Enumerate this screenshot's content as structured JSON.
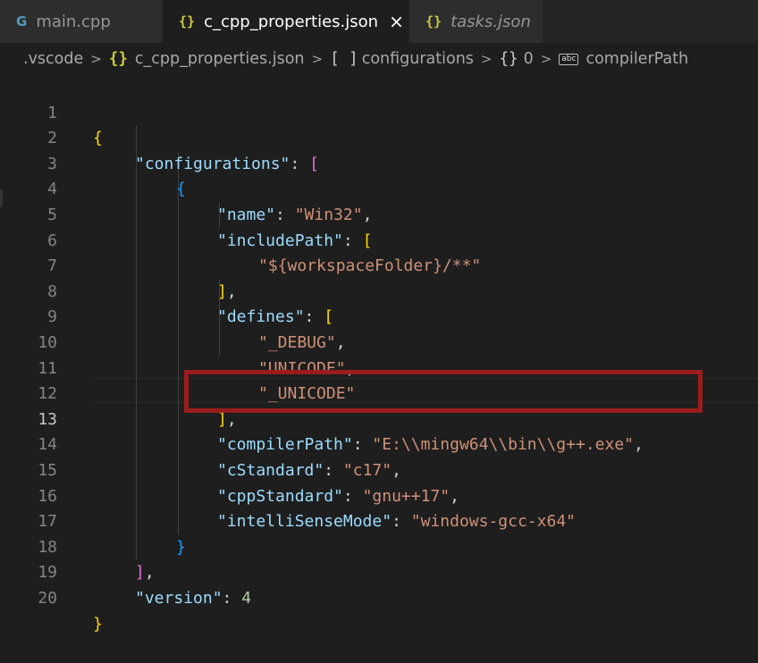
{
  "tabs": [
    {
      "icon": "cpp-file-icon",
      "icon_glyph": "G",
      "label": "main.cpp"
    },
    {
      "icon": "json-file-icon",
      "icon_glyph": "{}",
      "label": "c_cpp_properties.json",
      "close": "×"
    },
    {
      "icon": "json-file-icon",
      "icon_glyph": "{}",
      "label": "tasks.json"
    }
  ],
  "breadcrumb": {
    "folder": "vscode_folder",
    "items": [
      {
        "label": ".vscode"
      },
      {
        "icon_glyph": "{}",
        "label": "c_cpp_properties.json"
      },
      {
        "icon_glyph": "[ ]",
        "label": "configurations"
      },
      {
        "icon_glyph": "{}",
        "label": "0"
      },
      {
        "icon_glyph": "abc",
        "label": "compilerPath"
      }
    ],
    "sep": ">"
  },
  "lines": [
    {
      "num": "1"
    },
    {
      "num": "2"
    },
    {
      "num": "3"
    },
    {
      "num": "4"
    },
    {
      "num": "5"
    },
    {
      "num": "6"
    },
    {
      "num": "7"
    },
    {
      "num": "8"
    },
    {
      "num": "9"
    },
    {
      "num": "10"
    },
    {
      "num": "11"
    },
    {
      "num": "12"
    },
    {
      "num": "13"
    },
    {
      "num": "14"
    },
    {
      "num": "15"
    },
    {
      "num": "16"
    },
    {
      "num": "17"
    },
    {
      "num": "18"
    },
    {
      "num": "19"
    },
    {
      "num": "20"
    }
  ],
  "code": {
    "l1_open": "{",
    "configurations_key": "\"configurations\"",
    "colon": ": ",
    "comma": ",",
    "lbracket": "[",
    "rbracket": "]",
    "lbrace": "{",
    "rbrace": "}",
    "name_key": "\"name\"",
    "name_val": "\"Win32\"",
    "includePath_key": "\"includePath\"",
    "include_val": "\"${workspaceFolder}/**\"",
    "defines_key": "\"defines\"",
    "define1": "\"_DEBUG\"",
    "define2": "\"UNICODE\"",
    "define3": "\"_UNICODE\"",
    "compilerPath_key": "\"compilerPath\"",
    "compilerPath_val": "\"E:\\\\mingw64\\\\bin\\\\g++.exe\"",
    "cStandard_key": "\"cStandard\"",
    "cStandard_val": "\"c17\"",
    "cppStandard_key": "\"cppStandard\"",
    "cppStandard_val": "\"gnu++17\"",
    "intelliSenseMode_key": "\"intelliSenseMode\"",
    "intelliSenseMode_val": "\"windows-gcc-x64\"",
    "version_key": "\"version\"",
    "version_val": "4"
  },
  "colors": {
    "key": "#9cdcfe",
    "string": "#ce9178",
    "number": "#b5cea8",
    "highlight": "#9b1c1c"
  }
}
